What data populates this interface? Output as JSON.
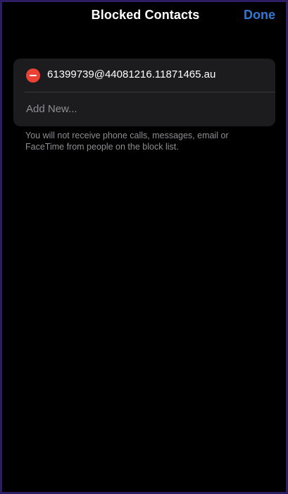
{
  "nav": {
    "title": "Blocked Contacts",
    "done_label": "Done"
  },
  "blocked_list": {
    "items": [
      {
        "contact": "61399739@44081216.11871465.au",
        "remove_icon": "minus-circle-icon"
      }
    ],
    "add_new_label": "Add New..."
  },
  "footer": {
    "note": "You will not receive phone calls, messages, email or FaceTime from people on the block list."
  },
  "colors": {
    "background": "#000000",
    "cell_background": "#1c1c1e",
    "accent": "#3478d6",
    "destructive": "#ea4335",
    "secondary_text": "#8e8e93",
    "frame_border": "#2d1d63"
  }
}
